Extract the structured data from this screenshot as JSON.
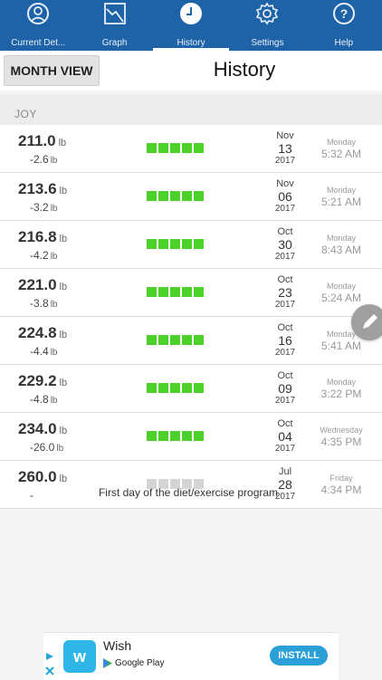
{
  "tabs": [
    {
      "label": "Current Det...",
      "icon": "face-icon"
    },
    {
      "label": "Graph",
      "icon": "graph-icon"
    },
    {
      "label": "History",
      "icon": "clock-icon",
      "active": true
    },
    {
      "label": "Settings",
      "icon": "gear-icon"
    },
    {
      "label": "Help",
      "icon": "help-icon"
    }
  ],
  "header": {
    "month_view_label": "MONTH VIEW",
    "title": "History"
  },
  "section": {
    "name": "JOY"
  },
  "units": {
    "weight": "lb"
  },
  "colors": {
    "accent": "#1e63a8",
    "progress": "#4cd12a",
    "progress_empty": "#d4d4d4"
  },
  "entries": [
    {
      "weight": "211.0",
      "diff": "-2.6",
      "progress": 5,
      "month": "Nov",
      "day": "13",
      "year": "2017",
      "weekday": "Monday",
      "time": "5:32 AM"
    },
    {
      "weight": "213.6",
      "diff": "-3.2",
      "progress": 5,
      "month": "Nov",
      "day": "06",
      "year": "2017",
      "weekday": "Monday",
      "time": "5:21 AM"
    },
    {
      "weight": "216.8",
      "diff": "-4.2",
      "progress": 5,
      "month": "Oct",
      "day": "30",
      "year": "2017",
      "weekday": "Monday",
      "time": "8:43 AM"
    },
    {
      "weight": "221.0",
      "diff": "-3.8",
      "progress": 5,
      "month": "Oct",
      "day": "23",
      "year": "2017",
      "weekday": "Monday",
      "time": "5:24 AM"
    },
    {
      "weight": "224.8",
      "diff": "-4.4",
      "progress": 5,
      "month": "Oct",
      "day": "16",
      "year": "2017",
      "weekday": "Monday",
      "time": "5:41 AM"
    },
    {
      "weight": "229.2",
      "diff": "-4.8",
      "progress": 5,
      "month": "Oct",
      "day": "09",
      "year": "2017",
      "weekday": "Monday",
      "time": "3:22 PM"
    },
    {
      "weight": "234.0",
      "diff": "-26.0",
      "progress": 5,
      "month": "Oct",
      "day": "04",
      "year": "2017",
      "weekday": "Wednesday",
      "time": "4:35 PM"
    },
    {
      "weight": "260.0",
      "diff": "-",
      "progress": 0,
      "note": "First day of the diet/exercise program",
      "month": "Jul",
      "day": "28",
      "year": "2017",
      "weekday": "Friday",
      "time": "4:34 PM"
    }
  ],
  "ad": {
    "brand": "Wish",
    "store": "Google Play",
    "install_label": "INSTALL"
  }
}
